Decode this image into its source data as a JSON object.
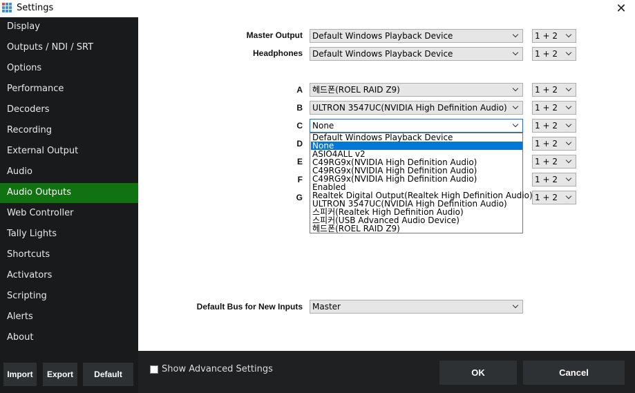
{
  "window": {
    "title": "Settings",
    "close_glyph": "✕"
  },
  "sidebar": {
    "items": [
      {
        "label": "Display"
      },
      {
        "label": "Outputs / NDI / SRT"
      },
      {
        "label": "Options"
      },
      {
        "label": "Performance"
      },
      {
        "label": "Decoders"
      },
      {
        "label": "Recording"
      },
      {
        "label": "External Output"
      },
      {
        "label": "Audio"
      },
      {
        "label": "Audio Outputs"
      },
      {
        "label": "Web Controller"
      },
      {
        "label": "Tally Lights"
      },
      {
        "label": "Shortcuts"
      },
      {
        "label": "Activators"
      },
      {
        "label": "Scripting"
      },
      {
        "label": "Alerts"
      },
      {
        "label": "About"
      }
    ],
    "active_index": 8,
    "buttons": {
      "import": "Import",
      "export": "Export",
      "default": "Default"
    }
  },
  "form": {
    "master": {
      "label": "Master Output",
      "device": "Default Windows Playback Device",
      "channels": "1 + 2"
    },
    "headphones": {
      "label": "Headphones",
      "device": "Default Windows Playback Device",
      "channels": "1 + 2"
    },
    "buses": [
      {
        "label": "A",
        "device": "헤드폰(ROEL RAID Z9)",
        "channels": "1 + 2"
      },
      {
        "label": "B",
        "device": "ULTRON 3547UC(NVIDIA High Definition Audio)",
        "channels": "1 + 2"
      },
      {
        "label": "C",
        "device": "None",
        "channels": "1 + 2"
      },
      {
        "label": "D",
        "channels": "1 + 2"
      },
      {
        "label": "E",
        "channels": "1 + 2"
      },
      {
        "label": "F",
        "channels": "1 + 2"
      },
      {
        "label": "G",
        "channels": "1 + 2"
      }
    ],
    "dropdown_options": [
      "Default Windows Playback Device",
      "None",
      "ASIO4ALL v2",
      "C49RG9x(NVIDIA High Definition Audio)",
      "C49RG9x(NVIDIA High Definition Audio)",
      "C49RG9x(NVIDIA High Definition Audio)",
      "Enabled",
      "Realtek Digital Output(Realtek High Definition Audio)",
      "ULTRON 3547UC(NVIDIA High Definition Audio)",
      "스피커(Realtek High Definition Audio)",
      "스피커(USB Advanced Audio Device)",
      "헤드폰(ROEL RAID Z9)"
    ],
    "dropdown_selected_index": 1,
    "default_bus": {
      "label": "Default Bus for New Inputs",
      "value": "Master"
    }
  },
  "footer": {
    "show_advanced_label": "Show Advanced Settings",
    "show_advanced_checked": false,
    "ok": "OK",
    "cancel": "Cancel"
  },
  "colors": {
    "sidebar_bg": "#181a1b",
    "active_nav": "#107210",
    "footer_bg": "#1e2022",
    "button_bg": "#2e3133",
    "highlight": "#0078d7"
  }
}
